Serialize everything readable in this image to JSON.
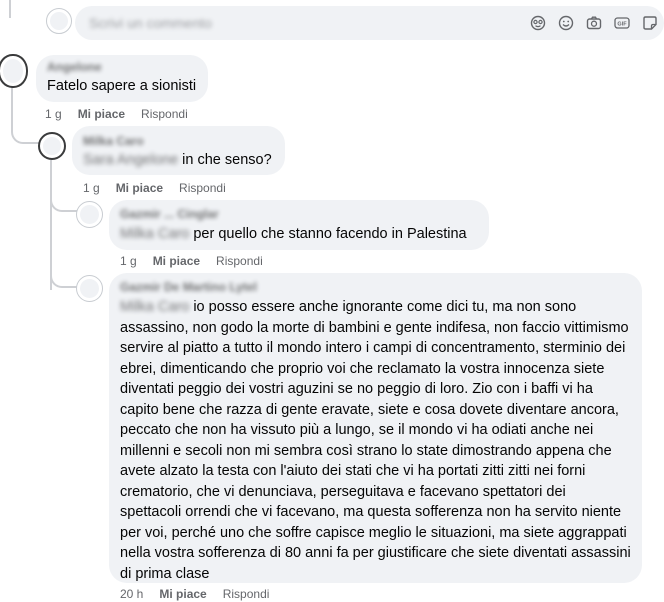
{
  "composer": {
    "placeholder": "Scrivi un commento",
    "icons": [
      "avatar-sticker-icon",
      "emoji-icon",
      "camera-icon",
      "gif-icon",
      "sticker-icon"
    ]
  },
  "comments": [
    {
      "author": "Angelone",
      "text": "Fatelo sapere a sionisti",
      "time": "1 g",
      "like": "Mi piace",
      "reply": "Rispondi"
    },
    {
      "author": "Milka Caro",
      "tag": "Sara Angelone",
      "text": "in che senso?",
      "time": "1 g",
      "like": "Mi piace",
      "reply": "Rispondi"
    },
    {
      "author": "Gazmir ... Cinglar",
      "tag": "Milka Caro",
      "text": "per quello che stanno facendo in Palestina",
      "time": "1 g",
      "like": "Mi piace",
      "reply": "Rispondi"
    },
    {
      "author": "Gazmir De Martino Lytel",
      "tag": "Milka Caro",
      "text": "io posso essere anche ignorante come dici tu, ma non sono assassino, non godo la morte di bambini e gente indifesa, non faccio vittimismo servire al piatto a tutto il mondo intero i campi di concentramento, sterminio dei ebrei, dimenticando che proprio voi che reclamato la vostra innocenza siete diventati peggio dei vostri aguzini se no peggio di loro. Zio con i baffi vi ha capito bene che razza di gente eravate, siete e cosa dovete diventare ancora, peccato che non ha vissuto più a lungo, se il mondo vi ha odiati anche nei millenni e secoli non mi sembra così strano lo state dimostrando appena che avete alzato la testa con l'aiuto dei stati che vi ha portati zitti zitti nei forni crematorio, che vi denunciava, perseguitava e facevano spettatori dei spettacoli orrendi che vi facevano, ma questa sofferenza non ha servito niente per voi, perché uno che soffre capisce meglio le situazioni, ma siete aggrappati nella vostra sofferenza di 80 anni fa per giustificare che siete diventati assassini di prima clase",
      "time": "20 h",
      "like": "Mi piace",
      "reply": "Rispondi"
    }
  ]
}
